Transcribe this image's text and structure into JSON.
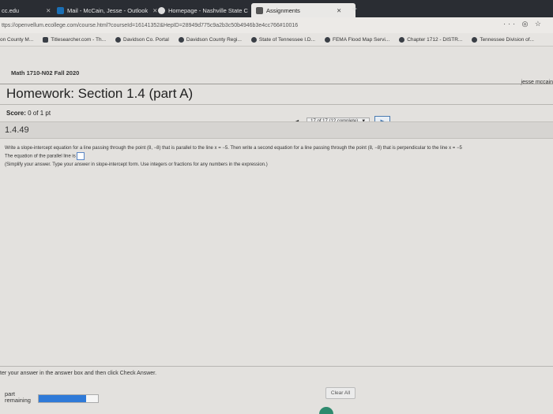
{
  "tabs": [
    {
      "label": "cc.edu",
      "color": "#e8e8e8"
    },
    {
      "label": "Mail - McCain, Jesse - Outlook",
      "color": "#1a6fb5"
    },
    {
      "label": "Homepage - Nashville State C",
      "color": "#e8e8e8"
    },
    {
      "label": "Assignments",
      "color": "#555555"
    }
  ],
  "url": "ttps://openvellum.ecollege.com/course.html?courseId=16141352&HepID=28949d775c9a2b3c50b4946b3e4cc766#10016",
  "bookmarks": [
    "on County M...",
    "Titlesearcher.com - Th...",
    "Davidson Co. Portal",
    "Davidson County Regi...",
    "State of Tennessee I.D...",
    "FEMA Flood Map Servi...",
    "Chapter 1712 - DISTR...",
    "Tennessee Division of..."
  ],
  "course": "Math 1710-N02 Fall 2020",
  "user": "jesse mccain",
  "homework_title": "Homework: Section 1.4 (part A)",
  "score_label": "Score:",
  "score_value": "0 of 1 pt",
  "question_progress": "17 of 17 (12 complete)",
  "question_number": "1.4.49",
  "question_text": "Write a slope-intercept equation for a line passing through the point (8, −8) that is parallel to the line x = −5. Then write a second equation for a line passing through the point (8, −8) that is perpendicular to the line x = −5",
  "parallel_label": "The equation of the parallel line is",
  "instructions": "(Simplify your answer. Type your answer in slope-intercept form. Use integers or fractions for any numbers in the expression.)",
  "bottom_instruction": "ter your answer in the answer box and then click Check Answer.",
  "clear_all": "Clear All",
  "part_label": "part",
  "remaining_label": "remaining",
  "part_progress": 0.8,
  "accent": "#2f7ad8"
}
